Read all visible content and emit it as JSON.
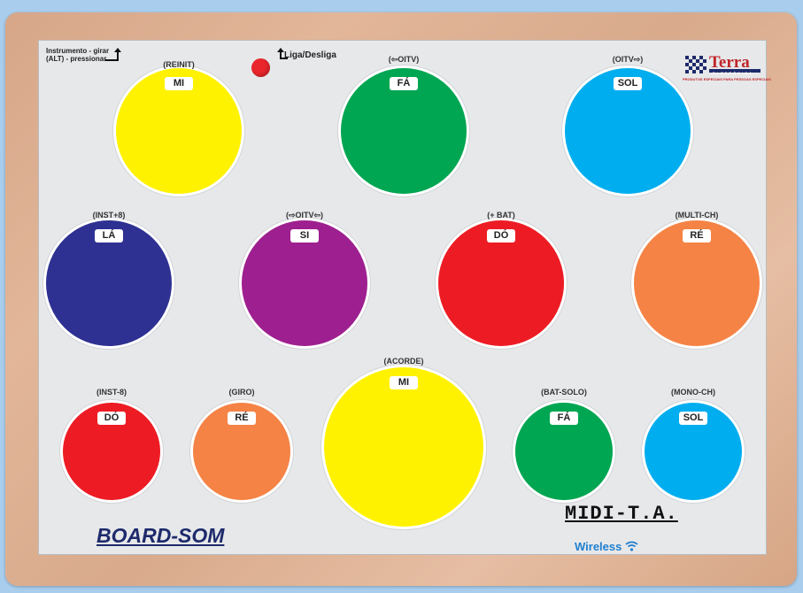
{
  "labels": {
    "instrument_hint_line1": "Instrumento - girar",
    "instrument_hint_line2": "(ALT) - pressionar",
    "power_label": "Liga/Desliga",
    "brand_title": "BOARD-SOM",
    "midi_logo": "MIDI-T.A.",
    "wireless_label": "Wireless",
    "terra_name": "Terra",
    "terra_sub": "ELETRÔNICA",
    "terra_tagline": "PRODUTOS ESPECIAIS PARA PESSOAS ESPECIAIS"
  },
  "colors": {
    "yellow": "#fff200",
    "green": "#00a651",
    "cyan": "#00aeef",
    "navy": "#2e3192",
    "purple": "#9e1f8f",
    "red": "#ed1c24",
    "orange": "#f58345",
    "led_red": "#e8262c"
  },
  "pads": [
    {
      "note": "MI",
      "function": "(REINIT)",
      "color": "yellow"
    },
    {
      "note": "FÁ",
      "function": "(⇦OITV)",
      "color": "green"
    },
    {
      "note": "SOL",
      "function": "(OITV⇨)",
      "color": "cyan"
    },
    {
      "note": "LÁ",
      "function": "(INST+8)",
      "color": "navy"
    },
    {
      "note": "SI",
      "function": "(⇨OITV⇦)",
      "color": "purple"
    },
    {
      "note": "DÓ",
      "function": "(+ BAT)",
      "color": "red"
    },
    {
      "note": "RÉ",
      "function": "(MULTI-CH)",
      "color": "orange"
    },
    {
      "note": "DÓ",
      "function": "(INST-8)",
      "color": "red"
    },
    {
      "note": "RÉ",
      "function": "(GIRO)",
      "color": "orange"
    },
    {
      "note": "MI",
      "function": "(ACORDE)",
      "color": "yellow"
    },
    {
      "note": "FÁ",
      "function": "(BAT-SOLO)",
      "color": "green"
    },
    {
      "note": "SOL",
      "function": "(MONO-CH)",
      "color": "cyan"
    }
  ]
}
